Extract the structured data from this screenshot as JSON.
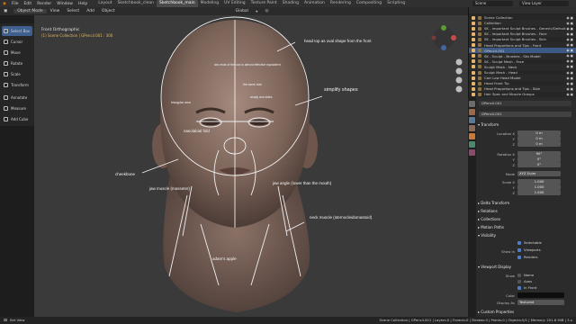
{
  "menu": {
    "items": [
      "File",
      "Edit",
      "Render",
      "Window",
      "Help"
    ],
    "workspaces": [
      "Layout",
      "Sketchbook_clean",
      "Sketchbook_main",
      "Modeling",
      "UV Editing",
      "Texture Paint",
      "Shading",
      "Animation",
      "Rendering",
      "Compositing",
      "Scripting"
    ],
    "active_workspace_index": 2,
    "scene": "Scene",
    "view_layer": "View Layer"
  },
  "header": {
    "mode": "Object Mode",
    "items": [
      "View",
      "Select",
      "Add",
      "Object"
    ],
    "orientation": "Global"
  },
  "toolbar": {
    "tools": [
      "Select Box",
      "Cursor",
      "Move",
      "Rotate",
      "Scale",
      "Transform",
      "Annotate",
      "Measure",
      "Add Cube"
    ],
    "active_index": 0
  },
  "viewport": {
    "title": "Front Orthographic",
    "subtitle": "(1) Scene Collection | GPencil.001 : 300",
    "annotations": [
      "head top as oval shape from the front",
      "two ends of the ovo is almost effective equivalent",
      "the same size",
      "triangular area",
      "amply and sides",
      "simplify shapes",
      "nasolabial fold",
      "cheekbone",
      "jaw muscle (masseter)",
      "jaw angle (lower than the mouth)",
      "neck muscle (sternocleidomastoid)",
      "adam's apple"
    ]
  },
  "outliner": {
    "rows": [
      "Scene Collection",
      "Collection",
      "SK - Important Sculpt Brushes - Generic/Default",
      "SK - Important Sculpt Brushes - Face",
      "SK - Important Sculpt Brushes - Skin",
      "Head Proportions and Tips - Front",
      "GPencil.001",
      "SK - Sculpt - Brushes - Sks Model",
      "SK - Sculpt Mesh - Face",
      "Sculpt Mesh - Neck",
      "Sculpt Mesh - Head",
      "Carr Low Head Model",
      "Head Front Tip",
      "Head Proportions and Tips - Side",
      "Hair Spec and Muscle Groups"
    ],
    "selected_index": 6
  },
  "properties": {
    "object_name": "GPencil.001",
    "object_name_field": "GPencil.001",
    "sections": {
      "transform": "Transform",
      "delta_transform": "Delta Transform",
      "relations": "Relations",
      "collections": "Collections",
      "motion_paths": "Motion Paths",
      "visibility": "Visibility",
      "viewport_display": "Viewport Display",
      "custom_properties": "Custom Properties"
    },
    "location_label": "Location X",
    "location": [
      "0 m",
      "0 m",
      "0 m"
    ],
    "rotation_label": "Rotation X",
    "rotation": [
      "90°",
      "0°",
      "0°"
    ],
    "mode_label": "Mode",
    "rotation_mode": "XYZ Euler",
    "scale_label": "Scale X",
    "scale": [
      "1.000",
      "1.000",
      "1.000"
    ],
    "axis_labels": [
      "X",
      "Y",
      "Z"
    ],
    "show_in_label": "Show in",
    "visibility_checks": [
      "Selectable",
      "Viewports",
      "Renders"
    ],
    "display": {
      "show_label": "Show",
      "options": [
        "Name",
        "Axes",
        "In Front"
      ],
      "color_label": "Color",
      "display_as_label": "Display As",
      "display_as": "Textured"
    }
  },
  "status": {
    "left": "Set View",
    "right": "Scene Collection | GPencil.001 | Layers:0 | Frames:0 | Strokes:0 | Points:0 | Objects:0/1 | Memory: 201.8 MiB | 3.x"
  }
}
